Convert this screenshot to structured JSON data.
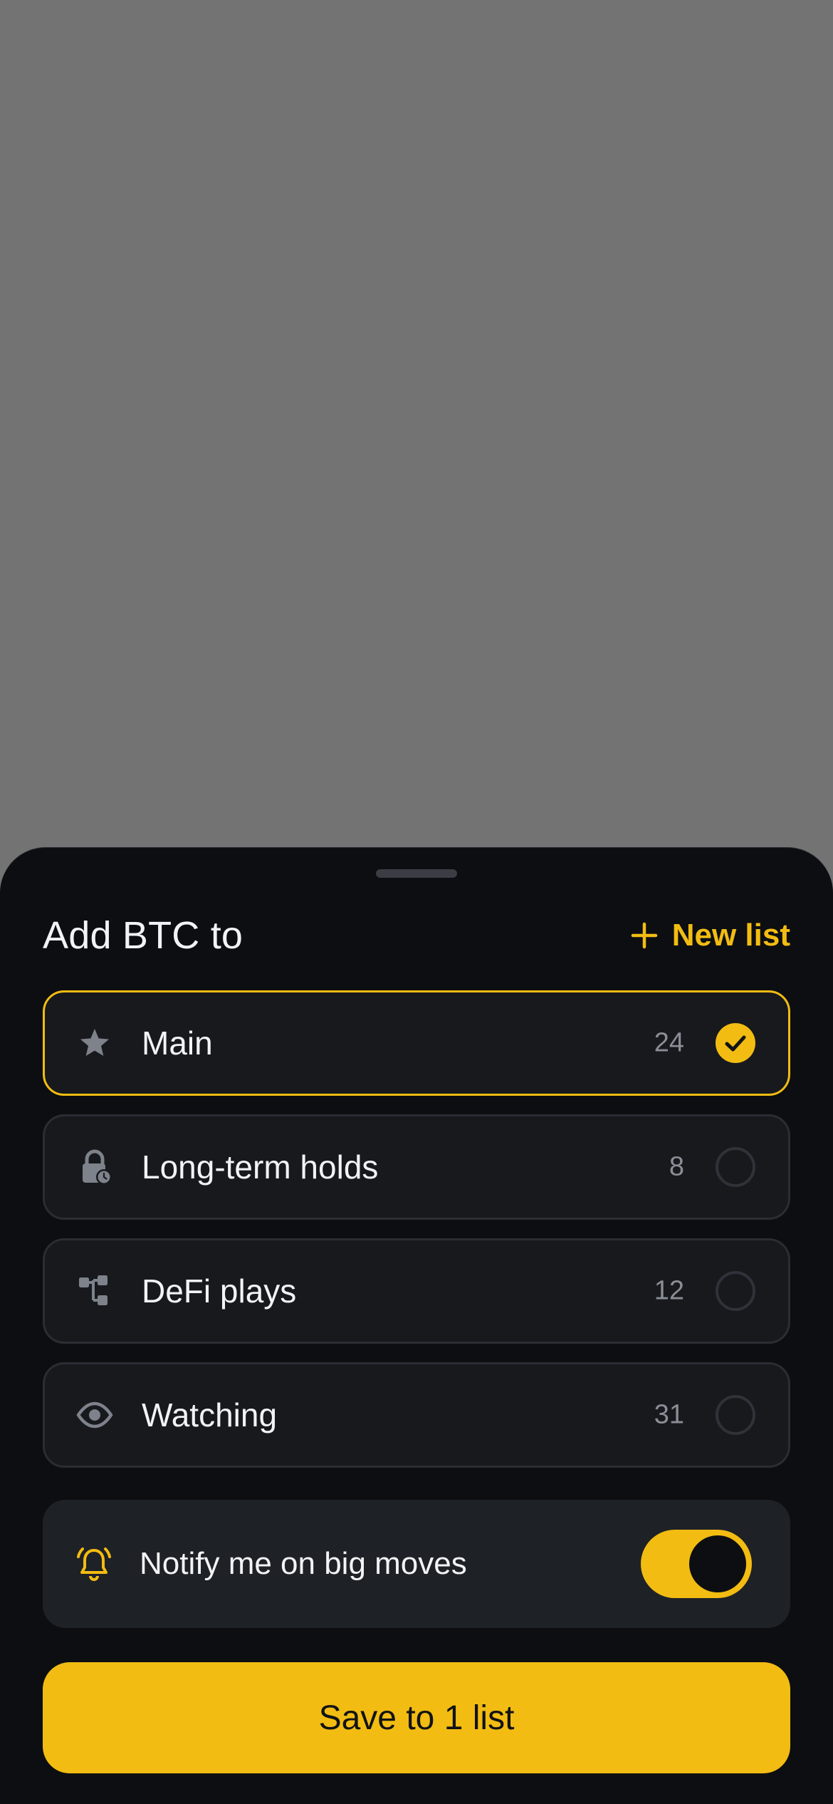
{
  "sheet": {
    "title": "Add BTC to",
    "new_list_label": "New list",
    "new_list_icon": "plus-icon"
  },
  "lists": [
    {
      "label": "Main",
      "count": "24",
      "icon": "star-icon",
      "selected": true
    },
    {
      "label": "Long-term holds",
      "count": "8",
      "icon": "lock-clock-icon",
      "selected": false
    },
    {
      "label": "DeFi plays",
      "count": "12",
      "icon": "hierarchy-icon",
      "selected": false
    },
    {
      "label": "Watching",
      "count": "31",
      "icon": "eye-icon",
      "selected": false
    }
  ],
  "notify": {
    "label": "Notify me on big moves",
    "icon": "bell-ringing-icon",
    "enabled": true
  },
  "save_button": {
    "label": "Save to 1 list"
  },
  "colors": {
    "accent": "#f2bc12",
    "sheet_background": "#0c0e11",
    "row_background": "#17191d",
    "backdrop": "#737373"
  }
}
